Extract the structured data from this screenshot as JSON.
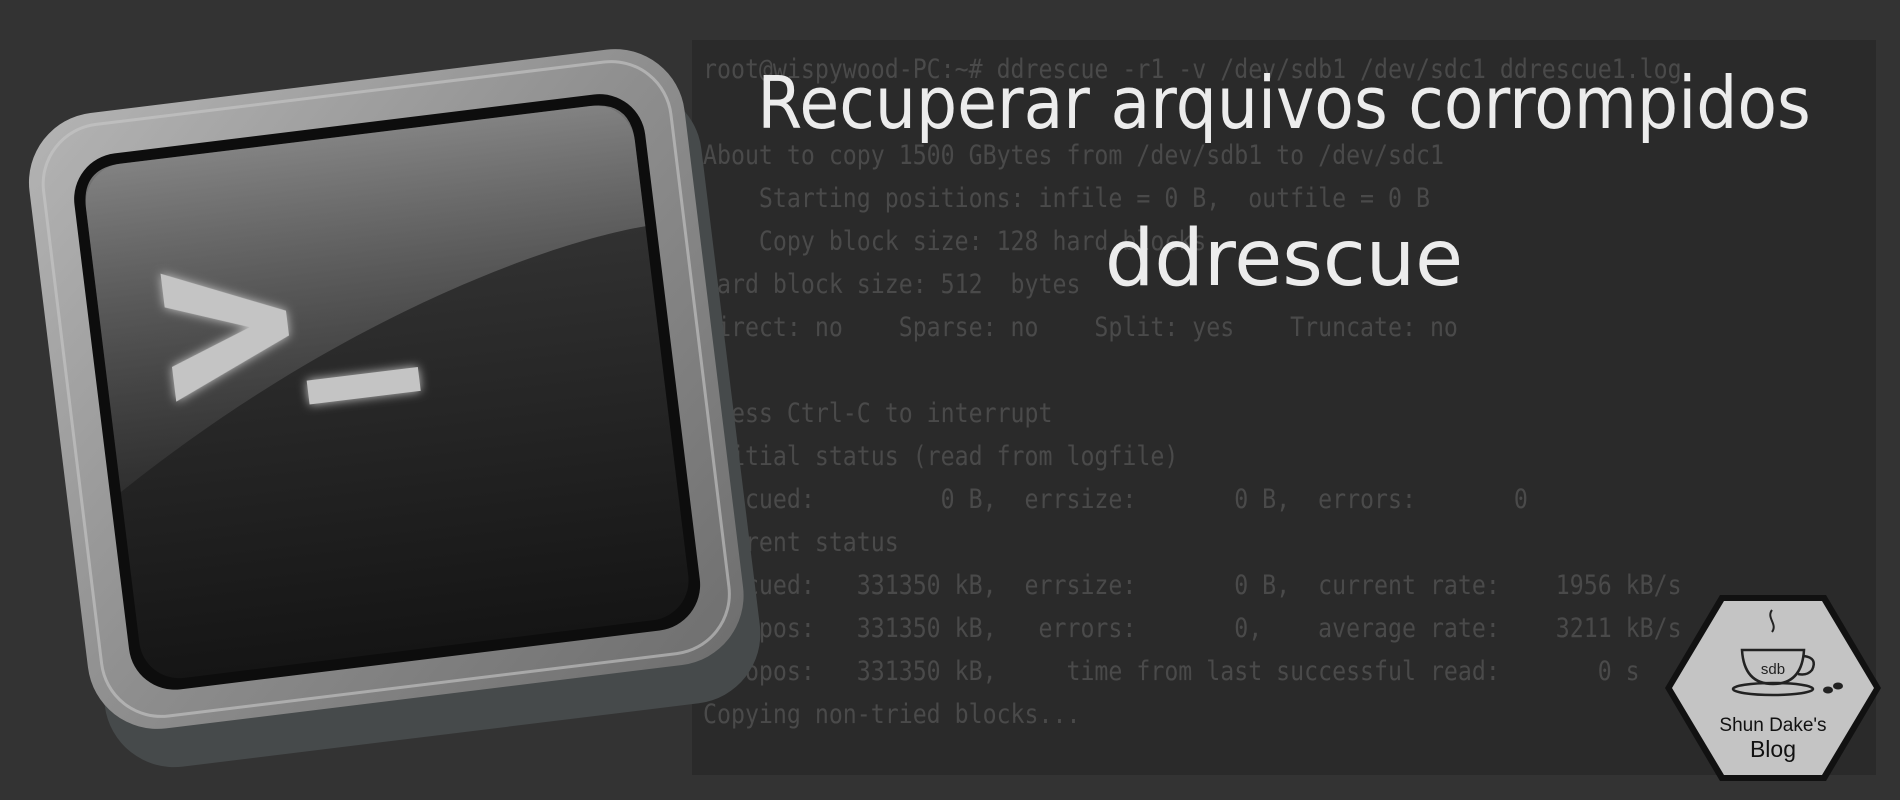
{
  "terminal": {
    "lines": [
      "root@wispywood-PC:~# ddrescue -r1 -v /dev/sdb1 /dev/sdc1 ddrescue1.log",
      "",
      "About to copy 1500 GBytes from /dev/sdb1 to /dev/sdc1",
      "    Starting positions: infile = 0 B,  outfile = 0 B",
      "    Copy block size: 128 hard blocks",
      "Hard block size: 512  bytes",
      "Direct: no    Sparse: no    Split: yes    Truncate: no",
      "",
      "Press Ctrl-C to interrupt",
      "Initial status (read from logfile)",
      "rescued:         0 B,  errsize:       0 B,  errors:       0",
      "Current status",
      "rescued:   331350 kB,  errsize:       0 B,  current rate:    1956 kB/s",
      "   ipos:   331350 kB,   errors:       0,    average rate:    3211 kB/s",
      "   opos:   331350 kB,     time from last successful read:       0 s",
      "Copying non-tried blocks..."
    ]
  },
  "headline": {
    "title": "Recuperar arquivos corrompidos",
    "subtitle": "ddrescue"
  },
  "icon": {
    "name": "terminal-icon",
    "prompt_glyph": ">_"
  },
  "logo": {
    "name": "coffee-cup-icon",
    "cup_label": "sdb",
    "name_line": "Shun Dake's",
    "blog_line": "Blog"
  },
  "colors": {
    "background": "#333333",
    "terminal_panel": "#2a2a2a",
    "terminal_text": "#4a4a4a",
    "headline_text": "#ececec",
    "logo_fill": "#c4c4c4"
  }
}
